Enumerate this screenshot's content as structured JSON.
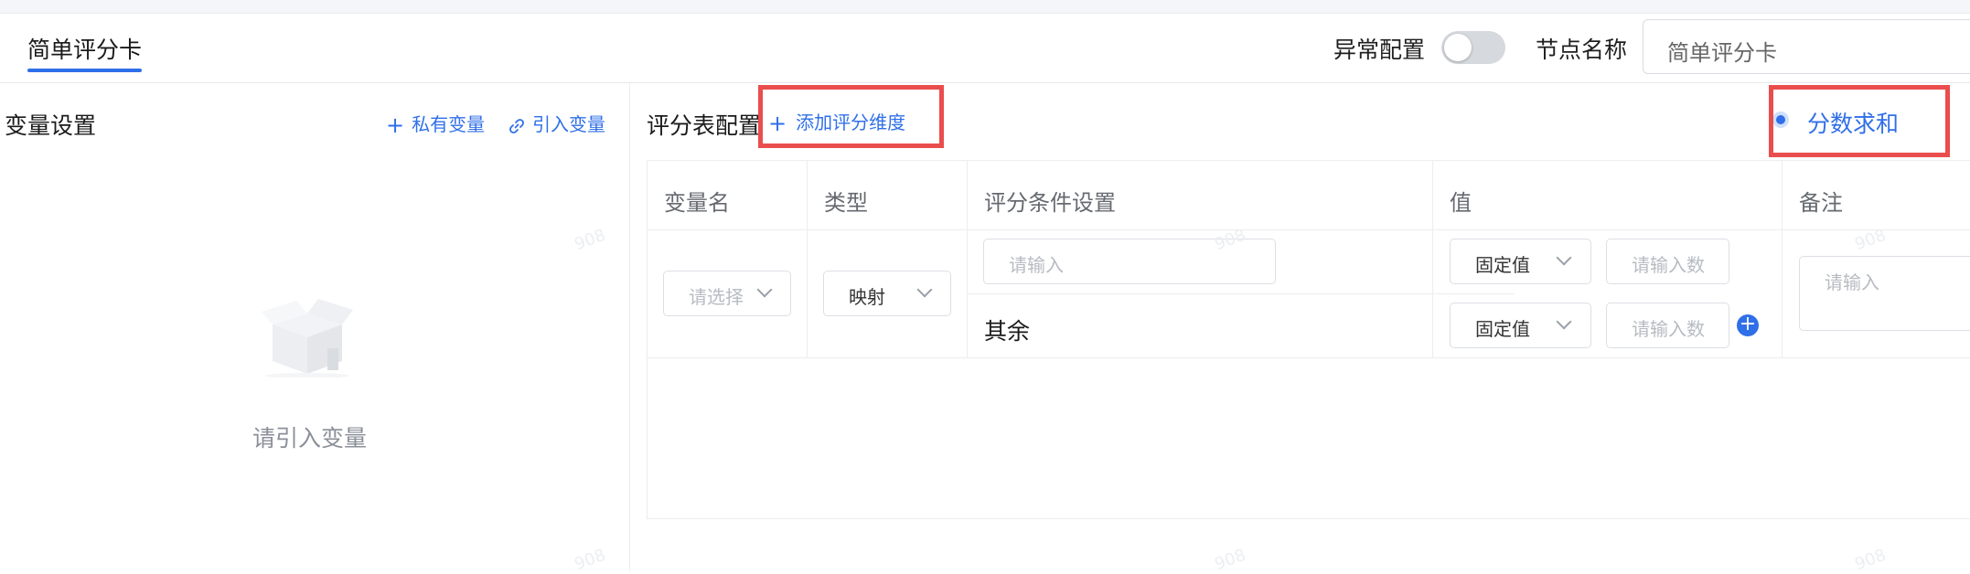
{
  "header": {
    "tab_label": "简单评分卡",
    "abnormal_config_label": "异常配置",
    "abnormal_config_on": false,
    "node_name_label": "节点名称",
    "node_name_value": "简单评分卡"
  },
  "variables": {
    "title": "变量设置",
    "private_var_label": "私有变量",
    "import_var_label": "引入变量",
    "empty_text": "请引入变量"
  },
  "score_table": {
    "title": "评分表配置",
    "add_dimension_label": "添加评分维度",
    "mode_label": "分数求和",
    "columns": [
      "变量名",
      "类型",
      "评分条件设置",
      "值",
      "备注"
    ],
    "row": {
      "var_select_placeholder": "请选择",
      "type_value": "映射",
      "condition_placeholder": "请输入",
      "other_label": "其余",
      "value_type_1": "固定值",
      "value_input_placeholder_1": "请输入数",
      "value_type_2": "固定值",
      "value_input_placeholder_2": "请输入数",
      "remark_placeholder": "请输入"
    }
  },
  "watermark_text": "908",
  "colors": {
    "accent": "#2f6fe8",
    "highlight_box": "#ea4d4d"
  }
}
